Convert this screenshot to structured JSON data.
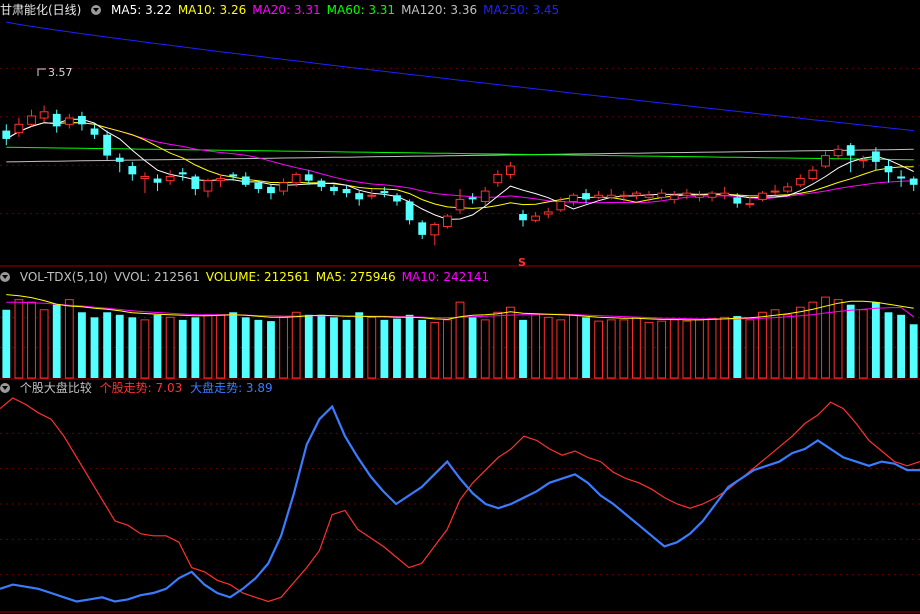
{
  "price_panel": {
    "stock_name": "甘肃能化(日线)",
    "ma_items": [
      {
        "label": "MA5: 3.22",
        "color": "#ffffff"
      },
      {
        "label": "MA10: 3.26",
        "color": "#ffff00"
      },
      {
        "label": "MA20: 3.31",
        "color": "#ff00ff"
      },
      {
        "label": "MA60: 3.31",
        "color": "#00ff00"
      },
      {
        "label": "MA120: 3.36",
        "color": "#c0c0c0"
      },
      {
        "label": "MA250: 3.45",
        "color": "#2020ff"
      }
    ],
    "high_label": "3.57",
    "signal_mark": "S",
    "candle_color_up": "#ff3030",
    "candle_color_down": "#54ffff",
    "candles": [
      [
        3.45,
        3.41,
        3.48,
        3.38
      ],
      [
        3.44,
        3.48,
        3.51,
        3.42
      ],
      [
        3.48,
        3.52,
        3.55,
        3.47
      ],
      [
        3.51,
        3.54,
        3.57,
        3.49
      ],
      [
        3.53,
        3.47,
        3.55,
        3.44
      ],
      [
        3.48,
        3.51,
        3.53,
        3.46
      ],
      [
        3.52,
        3.48,
        3.54,
        3.45
      ],
      [
        3.46,
        3.43,
        3.48,
        3.41
      ],
      [
        3.43,
        3.33,
        3.45,
        3.31
      ],
      [
        3.32,
        3.3,
        3.34,
        3.25
      ],
      [
        3.28,
        3.24,
        3.3,
        3.21
      ],
      [
        3.22,
        3.23,
        3.25,
        3.15
      ],
      [
        3.22,
        3.2,
        3.24,
        3.16
      ],
      [
        3.21,
        3.23,
        3.26,
        3.19
      ],
      [
        3.25,
        3.24,
        3.27,
        3.21
      ],
      [
        3.23,
        3.17,
        3.24,
        3.14
      ],
      [
        3.16,
        3.21,
        3.22,
        3.13
      ],
      [
        3.21,
        3.22,
        3.24,
        3.18
      ],
      [
        3.24,
        3.23,
        3.25,
        3.21
      ],
      [
        3.23,
        3.19,
        3.25,
        3.18
      ],
      [
        3.2,
        3.17,
        3.21,
        3.15
      ],
      [
        3.18,
        3.15,
        3.19,
        3.12
      ],
      [
        3.16,
        3.2,
        3.22,
        3.14
      ],
      [
        3.2,
        3.24,
        3.25,
        3.18
      ],
      [
        3.24,
        3.21,
        3.26,
        3.19
      ],
      [
        3.21,
        3.18,
        3.22,
        3.16
      ],
      [
        3.18,
        3.16,
        3.19,
        3.14
      ],
      [
        3.17,
        3.15,
        3.19,
        3.13
      ],
      [
        3.15,
        3.12,
        3.16,
        3.09
      ],
      [
        3.14,
        3.14,
        3.17,
        3.12
      ],
      [
        3.16,
        3.15,
        3.18,
        3.13
      ],
      [
        3.14,
        3.11,
        3.15,
        3.09
      ],
      [
        3.11,
        3.02,
        3.12,
        3.0
      ],
      [
        3.01,
        2.95,
        3.02,
        2.93
      ],
      [
        2.95,
        3.0,
        3.01,
        2.9
      ],
      [
        2.99,
        3.04,
        3.05,
        2.98
      ],
      [
        3.07,
        3.12,
        3.17,
        3.05
      ],
      [
        3.13,
        3.12,
        3.15,
        3.1
      ],
      [
        3.11,
        3.16,
        3.18,
        3.09
      ],
      [
        3.2,
        3.24,
        3.26,
        3.18
      ],
      [
        3.24,
        3.28,
        3.3,
        3.22
      ],
      [
        3.05,
        3.02,
        3.07,
        2.99
      ],
      [
        3.02,
        3.04,
        3.06,
        3.01
      ],
      [
        3.05,
        3.06,
        3.08,
        3.03
      ],
      [
        3.07,
        3.11,
        3.13,
        3.06
      ],
      [
        3.11,
        3.14,
        3.15,
        3.09
      ],
      [
        3.15,
        3.12,
        3.17,
        3.1
      ],
      [
        3.13,
        3.14,
        3.16,
        3.12
      ],
      [
        3.13,
        3.14,
        3.17,
        3.12
      ],
      [
        3.14,
        3.14,
        3.16,
        3.11
      ],
      [
        3.14,
        3.15,
        3.16,
        3.12
      ],
      [
        3.13,
        3.14,
        3.16,
        3.11
      ],
      [
        3.13,
        3.15,
        3.17,
        3.12
      ],
      [
        3.12,
        3.14,
        3.16,
        3.1
      ],
      [
        3.14,
        3.15,
        3.17,
        3.12
      ],
      [
        3.13,
        3.14,
        3.16,
        3.11
      ],
      [
        3.13,
        3.15,
        3.16,
        3.11
      ],
      [
        3.14,
        3.15,
        3.18,
        3.12
      ],
      [
        3.13,
        3.1,
        3.15,
        3.08
      ],
      [
        3.1,
        3.1,
        3.13,
        3.08
      ],
      [
        3.12,
        3.15,
        3.16,
        3.11
      ],
      [
        3.16,
        3.16,
        3.19,
        3.14
      ],
      [
        3.16,
        3.18,
        3.2,
        3.15
      ],
      [
        3.19,
        3.22,
        3.24,
        3.18
      ],
      [
        3.22,
        3.26,
        3.28,
        3.21
      ],
      [
        3.28,
        3.33,
        3.35,
        3.27
      ],
      [
        3.33,
        3.36,
        3.38,
        3.31
      ],
      [
        3.38,
        3.33,
        3.39,
        3.25
      ],
      [
        3.31,
        3.31,
        3.33,
        3.27
      ],
      [
        3.35,
        3.3,
        3.37,
        3.26
      ],
      [
        3.28,
        3.25,
        3.31,
        3.2
      ],
      [
        3.23,
        3.22,
        3.26,
        3.18
      ],
      [
        3.22,
        3.19,
        3.23,
        3.16
      ]
    ]
  },
  "vol_panel": {
    "header": [
      {
        "label": "VOL-TDX(5,10)",
        "color": "#c0c0c0"
      },
      {
        "label": "VVOL: 212561",
        "color": "#c0c0c0"
      },
      {
        "label": "VOLUME: 212561",
        "color": "#ffff00"
      },
      {
        "label": "MA5: 275946",
        "color": "#ffff00"
      },
      {
        "label": "MA10: 242141",
        "color": "#ff00ff"
      }
    ],
    "volumes": [
      270000,
      310000,
      300000,
      270000,
      290000,
      310000,
      260000,
      240000,
      260000,
      250000,
      240000,
      230000,
      250000,
      240000,
      230000,
      240000,
      250000,
      250000,
      260000,
      240000,
      230000,
      225000,
      240000,
      260000,
      250000,
      250000,
      240000,
      230000,
      260000,
      240000,
      230000,
      235000,
      250000,
      230000,
      220000,
      230000,
      300000,
      240000,
      230000,
      260000,
      280000,
      230000,
      250000,
      240000,
      230000,
      250000,
      240000,
      225000,
      230000,
      230000,
      240000,
      220000,
      225000,
      230000,
      225000,
      230000,
      235000,
      240000,
      245000,
      230000,
      260000,
      270000,
      250000,
      280000,
      300000,
      320000,
      310000,
      290000,
      270000,
      300000,
      260000,
      250000,
      212561
    ],
    "ma5_line": [
      330000,
      325000,
      318000,
      306000,
      292000,
      285000,
      282000,
      276000,
      272000,
      266000,
      258000,
      255000,
      252000,
      250000,
      248000,
      246000,
      246000,
      248000,
      250000,
      248000,
      244000,
      240000,
      240000,
      242000,
      246000,
      248000,
      246000,
      244000,
      244000,
      243000,
      242000,
      240000,
      240000,
      238000,
      234000,
      232000,
      242000,
      248000,
      250000,
      254000,
      262000,
      256000,
      254000,
      252000,
      250000,
      248000,
      244000,
      240000,
      238000,
      236000,
      236000,
      234000,
      232000,
      232000,
      230000,
      230000,
      232000,
      234000,
      236000,
      238000,
      242000,
      248000,
      254000,
      262000,
      272000,
      284000,
      296000,
      304000,
      304000,
      300000,
      292000,
      284000,
      275946
    ],
    "ma10_line": [
      300000,
      300000,
      298000,
      296000,
      292000,
      288000,
      285000,
      280000,
      276000,
      271000,
      266000,
      262000,
      259000,
      256000,
      253000,
      251000,
      250000,
      250000,
      250000,
      249000,
      247000,
      246000,
      245000,
      245000,
      246000,
      246000,
      246000,
      245000,
      245000,
      244000,
      244000,
      243000,
      242000,
      241000,
      239000,
      238000,
      240000,
      242000,
      244000,
      246000,
      249000,
      250000,
      251000,
      252000,
      252000,
      251000,
      249000,
      247000,
      245000,
      243000,
      241000,
      239000,
      237000,
      236000,
      235000,
      234000,
      234000,
      234000,
      234000,
      235000,
      236000,
      239000,
      242000,
      246000,
      251000,
      257000,
      263000,
      268000,
      272000,
      276000,
      278000,
      279000,
      242141
    ]
  },
  "compare_panel": {
    "title": "个股大盘比较",
    "stock_label": "个股走势: 7.03",
    "index_label": "大盘走势: 3.89",
    "stock_color": "#ff3030",
    "index_color": "#3a7cff"
  }
}
